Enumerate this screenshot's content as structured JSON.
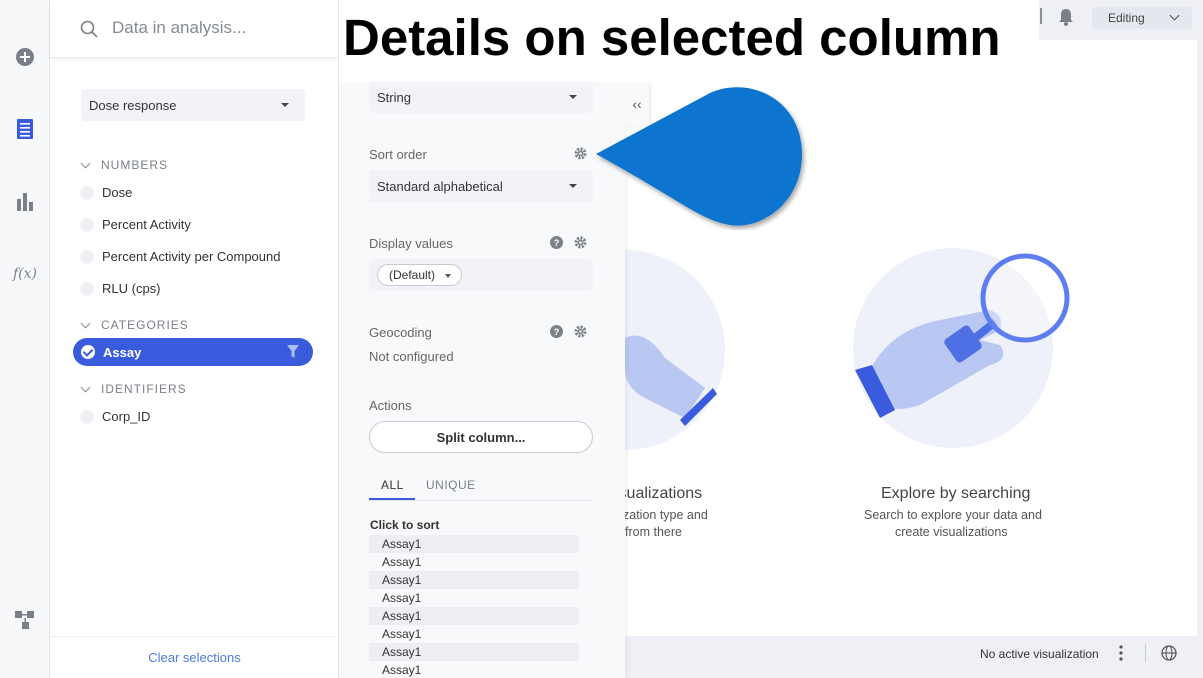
{
  "overlay": {
    "title": "Details on selected column"
  },
  "search": {
    "placeholder": "Data in analysis..."
  },
  "data_panel": {
    "table_select": "Dose response",
    "sections": [
      {
        "header": "NUMBERS",
        "items": [
          "Dose",
          "Percent Activity",
          "Percent Activity per Compound",
          "RLU (cps)"
        ]
      },
      {
        "header": "CATEGORIES",
        "items": [
          "Assay"
        ]
      },
      {
        "header": "IDENTIFIERS",
        "items": [
          "Corp_ID"
        ]
      }
    ],
    "clear_label": "Clear selections"
  },
  "details": {
    "data_type": "String",
    "sort_order_label": "Sort order",
    "sort_order_value": "Standard alphabetical",
    "display_values_label": "Display values",
    "display_values_value": "(Default)",
    "geocoding_label": "Geocoding",
    "geocoding_value": "Not configured",
    "actions_label": "Actions",
    "split_button": "Split column...",
    "tabs": [
      "ALL",
      "UNIQUE"
    ],
    "click_to_sort": "Click to sort",
    "values": [
      "Assay1",
      "Assay1",
      "Assay1",
      "Assay1",
      "Assay1",
      "Assay1",
      "Assay1",
      "Assay1"
    ],
    "collapse_glyph": "‹‹"
  },
  "canvas": {
    "card1": {
      "title": "isualizations",
      "line1": "zation type and",
      "line2": "from there"
    },
    "card2": {
      "title": "Explore by searching",
      "line1": "Search to explore your data and",
      "line2": "create visualizations"
    },
    "mode": "Editing",
    "status": "No active visualization"
  },
  "colors": {
    "accent": "#3a5bde",
    "callout": "#0a75d0",
    "link": "#4f7ae0"
  }
}
